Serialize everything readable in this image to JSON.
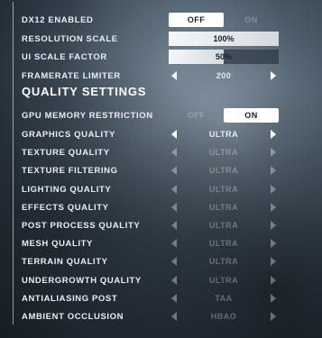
{
  "settings": {
    "dx12": {
      "label": "DX12 ENABLED",
      "off": "OFF",
      "on": "ON",
      "selected": "off"
    },
    "resolution_scale": {
      "label": "RESOLUTION SCALE",
      "value": "100%",
      "fraction": 1.0
    },
    "ui_scale": {
      "label": "UI SCALE FACTOR",
      "value": "50%",
      "fraction": 0.5
    },
    "framerate": {
      "label": "FRAMERATE LIMITER",
      "value": "200"
    }
  },
  "quality": {
    "title": "QUALITY SETTINGS",
    "gpu_memory": {
      "label": "GPU MEMORY RESTRICTION",
      "off": "OFF",
      "on": "ON",
      "selected": "on"
    },
    "items": [
      {
        "label": "GRAPHICS QUALITY",
        "value": "ULTRA",
        "enabled": true
      },
      {
        "label": "TEXTURE QUALITY",
        "value": "ULTRA",
        "enabled": false
      },
      {
        "label": "TEXTURE FILTERING",
        "value": "ULTRA",
        "enabled": false
      },
      {
        "label": "LIGHTING QUALITY",
        "value": "ULTRA",
        "enabled": false
      },
      {
        "label": "EFFECTS QUALITY",
        "value": "ULTRA",
        "enabled": false
      },
      {
        "label": "POST PROCESS QUALITY",
        "value": "ULTRA",
        "enabled": false
      },
      {
        "label": "MESH QUALITY",
        "value": "ULTRA",
        "enabled": false
      },
      {
        "label": "TERRAIN QUALITY",
        "value": "ULTRA",
        "enabled": false
      },
      {
        "label": "UNDERGROWTH QUALITY",
        "value": "ULTRA",
        "enabled": false
      },
      {
        "label": "ANTIALIASING POST",
        "value": "TAA",
        "enabled": false
      },
      {
        "label": "AMBIENT OCCLUSION",
        "value": "HBAO",
        "enabled": false
      }
    ]
  },
  "colors": {
    "accent": "#ffffff",
    "text": "#e9eef2",
    "dim": "#5a6672"
  }
}
